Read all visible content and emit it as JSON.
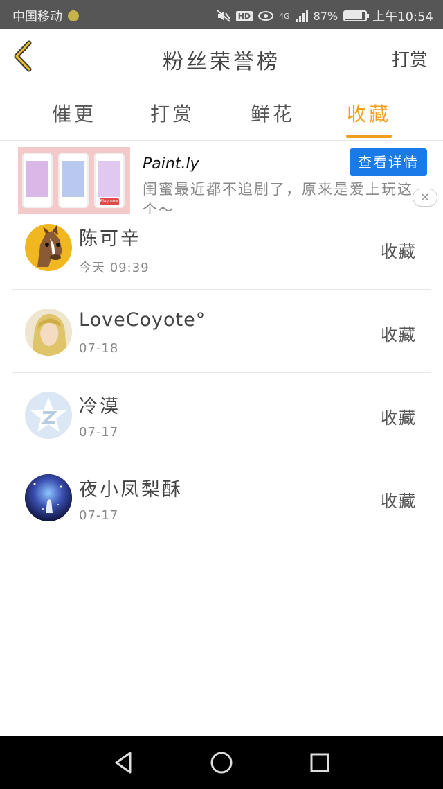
{
  "status_bar": {
    "carrier": "中国移动",
    "hd": "HD",
    "network": "4G",
    "battery_text": "87%",
    "battery_level": 0.87,
    "time": "上午10:54"
  },
  "header": {
    "title": "粉丝荣誉榜",
    "right_label": "打赏"
  },
  "tabs": [
    {
      "label": "催更",
      "active": false
    },
    {
      "label": "打赏",
      "active": false
    },
    {
      "label": "鲜花",
      "active": false
    },
    {
      "label": "收藏",
      "active": true
    }
  ],
  "ad": {
    "app_name": "Paint.ly",
    "description": "闺蜜最近都不追剧了，原来是爱上玩这个～",
    "button_label": "查看详情",
    "close_label": "✕",
    "play_label": "Play now"
  },
  "list": [
    {
      "name": "陈可辛",
      "time": "今天 09:39",
      "action": "收藏"
    },
    {
      "name": "LoveCoyote°",
      "time": "07-18",
      "action": "收藏"
    },
    {
      "name": "冷漠",
      "time": "07-17",
      "action": "收藏"
    },
    {
      "name": "夜小凤梨酥",
      "time": "07-17",
      "action": "收藏"
    }
  ],
  "colors": {
    "accent": "#f0a020",
    "ad_button": "#1a7ae8",
    "status_bar": "#565656"
  }
}
